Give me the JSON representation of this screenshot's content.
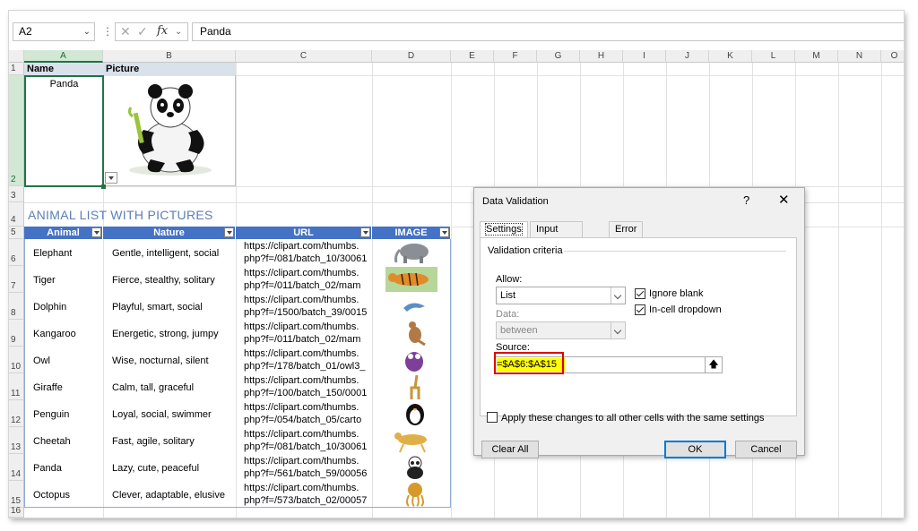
{
  "formula_bar": {
    "name_box": "A2",
    "fx_label": "fx",
    "formula": "Panda"
  },
  "columns": [
    "A",
    "B",
    "C",
    "D",
    "E",
    "F",
    "G",
    "H",
    "I",
    "J",
    "K",
    "L",
    "M",
    "N",
    "O"
  ],
  "rows": [
    "1",
    "2",
    "3",
    "4",
    "5",
    "6",
    "7",
    "8",
    "9",
    "10",
    "11",
    "12",
    "13",
    "14",
    "15",
    "16"
  ],
  "top_table": {
    "header_name": "Name",
    "header_picture": "Picture",
    "selected_value": "Panda"
  },
  "list_title": "ANIMAL LIST WITH PICTURES",
  "table": {
    "headers": [
      "Animal",
      "Nature",
      "URL",
      "IMAGE"
    ],
    "rows": [
      {
        "animal": "Elephant",
        "nature": "Gentle, intelligent, social",
        "url1": "https://clipart.com/thumbs.",
        "url2": "php?f=/081/batch_10/30061",
        "icon": "elephant-icon"
      },
      {
        "animal": "Tiger",
        "nature": "Fierce, stealthy, solitary",
        "url1": "https://clipart.com/thumbs.",
        "url2": "php?f=/011/batch_02/mam",
        "icon": "tiger-icon"
      },
      {
        "animal": "Dolphin",
        "nature": "Playful, smart, social",
        "url1": "https://clipart.com/thumbs.",
        "url2": "php?f=/1500/batch_39/0015",
        "icon": "dolphin-icon"
      },
      {
        "animal": "Kangaroo",
        "nature": "Energetic, strong, jumpy",
        "url1": "https://clipart.com/thumbs.",
        "url2": "php?f=/011/batch_02/mam",
        "icon": "kangaroo-icon"
      },
      {
        "animal": "Owl",
        "nature": "Wise, nocturnal, silent",
        "url1": "https://clipart.com/thumbs.",
        "url2": "php?f=/178/batch_01/owl3_",
        "icon": "owl-icon"
      },
      {
        "animal": "Giraffe",
        "nature": "Calm, tall, graceful",
        "url1": "https://clipart.com/thumbs.",
        "url2": "php?f=/100/batch_150/0001",
        "icon": "giraffe-icon"
      },
      {
        "animal": "Penguin",
        "nature": "Loyal, social, swimmer",
        "url1": "https://clipart.com/thumbs.",
        "url2": "php?f=/054/batch_05/carto",
        "icon": "penguin-icon"
      },
      {
        "animal": "Cheetah",
        "nature": "Fast, agile, solitary",
        "url1": "https://clipart.com/thumbs.",
        "url2": "php?f=/081/batch_10/30061",
        "icon": "cheetah-icon"
      },
      {
        "animal": "Panda",
        "nature": "Lazy, cute, peaceful",
        "url1": "https://clipart.com/thumbs.",
        "url2": "php?f=/561/batch_59/00056",
        "icon": "panda-icon"
      },
      {
        "animal": "Octopus",
        "nature": "Clever, adaptable, elusive",
        "url1": "https://clipart.com/thumbs.",
        "url2": "php?f=/573/batch_02/00057",
        "icon": "octopus-icon"
      }
    ]
  },
  "dialog": {
    "title": "Data Validation",
    "help": "?",
    "close": "✕",
    "tabs": [
      "Settings",
      "Input Message",
      "Error Alert"
    ],
    "group_label": "Validation criteria",
    "allow_label": "Allow:",
    "allow_value": "List",
    "data_label": "Data:",
    "data_value": "between",
    "ignore_blank": "Ignore blank",
    "in_cell_dropdown": "In-cell dropdown",
    "source_label": "Source:",
    "source_value": "=$A$6:$A$15",
    "apply_all": "Apply these changes to all other cells with the same settings",
    "clear_all": "Clear All",
    "ok": "OK",
    "cancel": "Cancel"
  }
}
